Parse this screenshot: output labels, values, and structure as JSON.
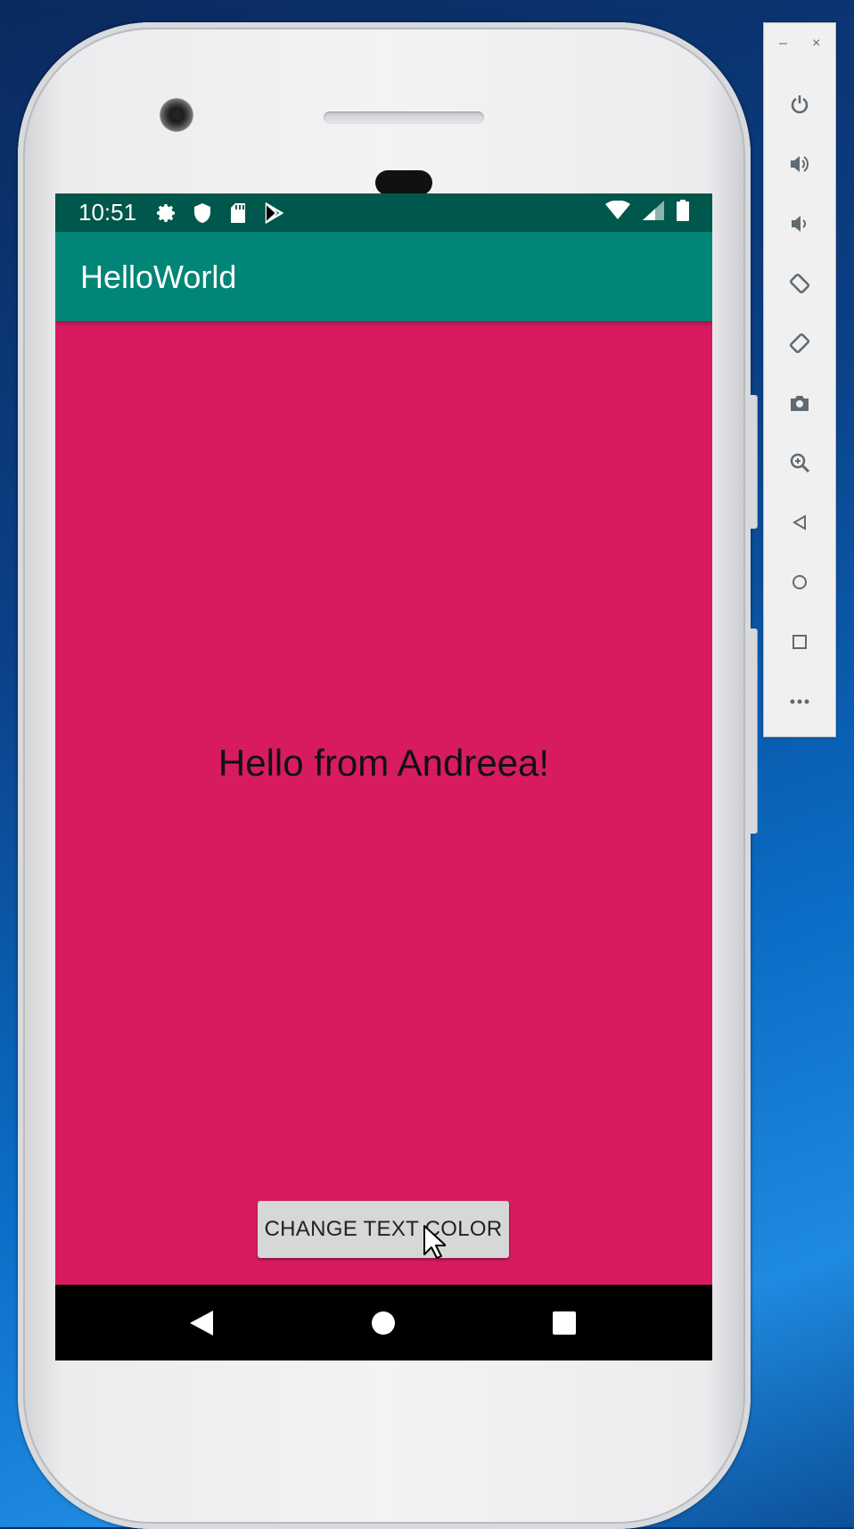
{
  "status_bar": {
    "time": "10:51",
    "left_icons": [
      "gear-icon",
      "shield-icon",
      "sd-card-icon",
      "play-store-icon"
    ],
    "right_icons": [
      "wifi-icon",
      "signal-icon",
      "battery-icon"
    ]
  },
  "app_bar": {
    "title": "HelloWorld"
  },
  "main": {
    "message": "Hello from Andreea!",
    "button_label": "CHANGE TEXT COLOR",
    "background_color": "#d81b60"
  },
  "nav_bar": {
    "buttons": [
      "back-icon",
      "home-icon",
      "recents-icon"
    ]
  },
  "emulator_toolbar": {
    "window_controls": {
      "minimize": "–",
      "close": "×"
    },
    "buttons": [
      "power-icon",
      "volume-up-icon",
      "volume-down-icon",
      "rotate-left-icon",
      "rotate-right-icon",
      "camera-icon",
      "zoom-icon",
      "back-icon",
      "home-icon",
      "overview-icon",
      "more-icon"
    ]
  },
  "colors": {
    "status_bar": "#00574b",
    "app_bar": "#008577",
    "accent": "#d81b60"
  }
}
